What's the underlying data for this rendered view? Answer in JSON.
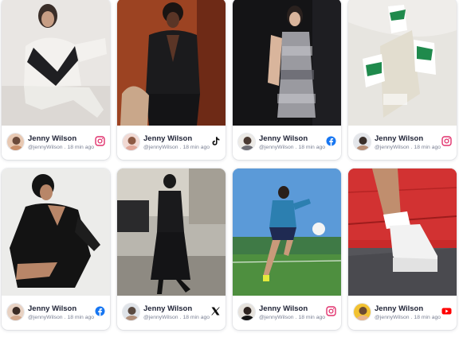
{
  "cards": [
    {
      "name": "Jenny Wilson",
      "handle": "@jennyWilson",
      "time": "18 min ago",
      "network": "instagram-icon"
    },
    {
      "name": "Jenny Wilson",
      "handle": "@jennyWilson",
      "time": "18 min ago",
      "network": "tiktok-icon"
    },
    {
      "name": "Jenny Wilson",
      "handle": "@jennyWilson",
      "time": "18 min ago",
      "network": "facebook-icon"
    },
    {
      "name": "Jenny Wilson",
      "handle": "@jennyWilson",
      "time": "18 min ago",
      "network": "instagram-icon"
    },
    {
      "name": "Jenny Wilson",
      "handle": "@jennyWilson",
      "time": "18 min ago",
      "network": "facebook-icon"
    },
    {
      "name": "Jenny Wilson",
      "handle": "@jennyWilson",
      "time": "18 min ago",
      "network": "x-icon"
    },
    {
      "name": "Jenny Wilson",
      "handle": "@jennyWilson",
      "time": "18 min ago",
      "network": "instagram-icon"
    },
    {
      "name": "Jenny Wilson",
      "handle": "@jennyWilson",
      "time": "18 min ago",
      "network": "youtube-icon"
    }
  ],
  "separator": ".",
  "colors": {
    "name_text": "#1e2235",
    "meta_text": "#7b8194",
    "instagram": "#e1306c",
    "facebook": "#1877f2",
    "youtube": "#ff0000",
    "tiktok": "#111111",
    "x": "#111111"
  }
}
